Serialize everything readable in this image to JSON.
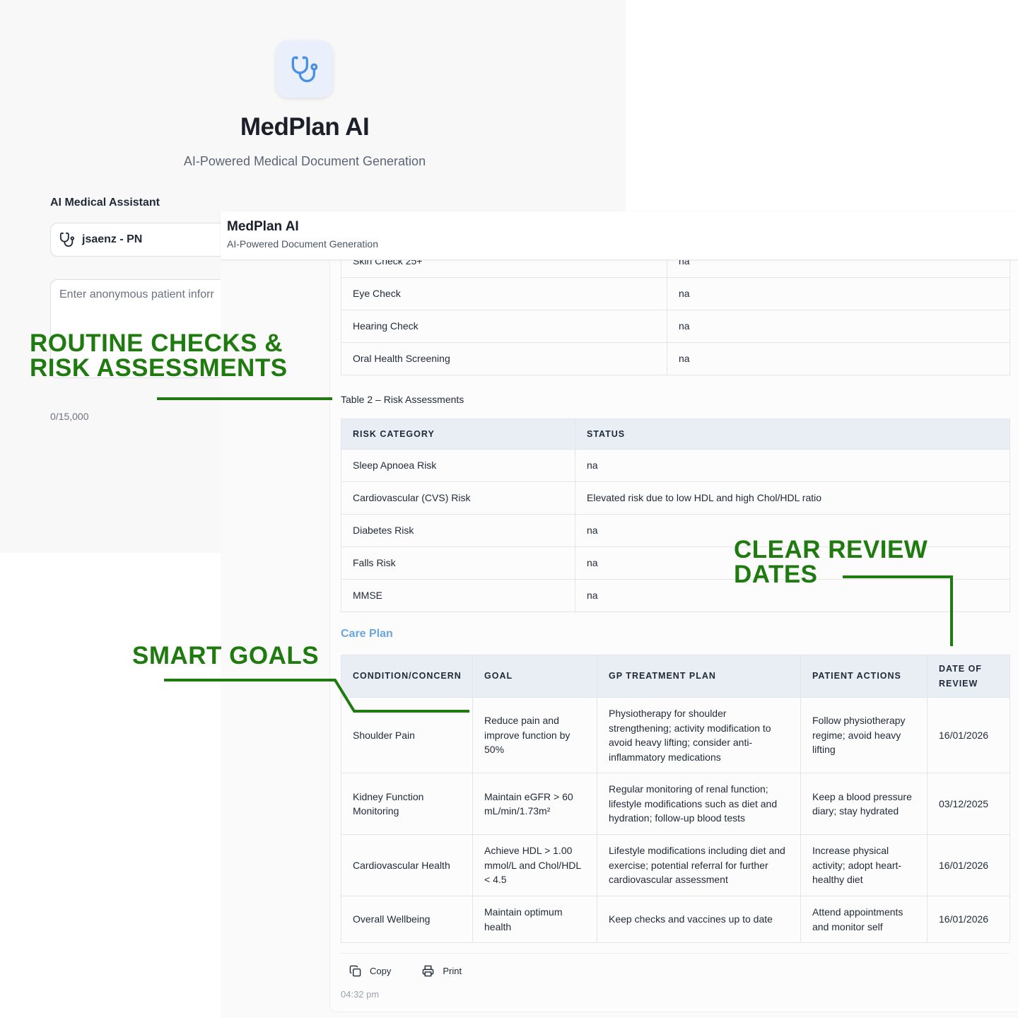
{
  "login": {
    "app_title": "MedPlan AI",
    "app_subtitle": "AI-Powered Medical Document Generation",
    "assistant_label": "AI Medical Assistant",
    "selected_user": "jsaenz - PN",
    "patient_placeholder": "Enter anonymous patient inforr",
    "char_count": "0/15,000"
  },
  "header": {
    "title": "MedPlan AI",
    "subtitle": "AI-Powered Document Generation"
  },
  "checks_table": {
    "rows": [
      [
        "Skin Check 25+",
        "na"
      ],
      [
        "Eye Check",
        "na"
      ],
      [
        "Hearing Check",
        "na"
      ],
      [
        "Oral Health Screening",
        "na"
      ]
    ]
  },
  "risk_table": {
    "caption": "Table 2 – Risk Assessments",
    "headers": [
      "RISK CATEGORY",
      "STATUS"
    ],
    "rows": [
      [
        "Sleep Apnoea Risk",
        "na"
      ],
      [
        "Cardiovascular (CVS) Risk",
        "Elevated risk due to low HDL and high Chol/HDL ratio"
      ],
      [
        "Diabetes Risk",
        "na"
      ],
      [
        "Falls Risk",
        "na"
      ],
      [
        "MMSE",
        "na"
      ]
    ]
  },
  "care_plan": {
    "heading": "Care Plan",
    "headers": [
      "CONDITION/CONCERN",
      "GOAL",
      "GP TREATMENT PLAN",
      "PATIENT ACTIONS",
      "DATE OF REVIEW"
    ],
    "rows": [
      [
        "Shoulder Pain",
        "Reduce pain and improve function by 50%",
        "Physiotherapy for shoulder strengthening; activity modification to avoid heavy lifting; consider anti-inflammatory medications",
        "Follow physiotherapy regime; avoid heavy lifting",
        "16/01/2026"
      ],
      [
        "Kidney Function Monitoring",
        "Maintain eGFR > 60 mL/min/1.73m²",
        "Regular monitoring of renal function; lifestyle modifications such as diet and hydration; follow-up blood tests",
        "Keep a blood pressure diary; stay hydrated",
        "03/12/2025"
      ],
      [
        "Cardiovascular Health",
        "Achieve HDL > 1.00 mmol/L and Chol/HDL < 4.5",
        "Lifestyle modifications including diet and exercise; potential referral for further cardiovascular assessment",
        "Increase physical activity; adopt heart-healthy diet",
        "16/01/2026"
      ],
      [
        "Overall Wellbeing",
        "Maintain optimum health",
        "Keep checks and vaccines up to date",
        "Attend appointments and monitor self",
        "16/01/2026"
      ]
    ]
  },
  "actions": {
    "copy_label": "Copy",
    "print_label": "Print",
    "timestamp": "04:32 pm"
  },
  "annotations": {
    "routine": [
      "ROUTINE CHECKS &",
      "RISK ASSESSMENTS"
    ],
    "review": [
      "CLEAR REVIEW",
      "DATES"
    ],
    "smart": "SMART GOALS",
    "color": "#1f7a0f"
  },
  "colors": {
    "accent_blue": "#6aa6e0",
    "header_row_bg": "#e9edf4",
    "logo_tile_bg": "#e9f0fb"
  }
}
